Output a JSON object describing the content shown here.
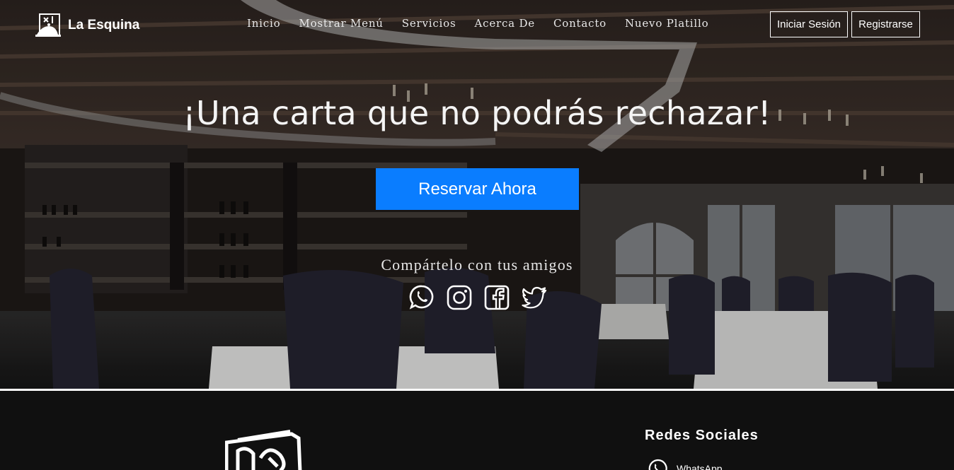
{
  "brand": {
    "name": "La Esquina",
    "logo_icon": "waiter-tray-icon"
  },
  "nav": {
    "links": [
      "Inicio",
      "Mostrar Menú",
      "Servicios",
      "Acerca De",
      "Contacto",
      "Nuevo Platillo"
    ],
    "login_label": "Iniciar Sesión",
    "register_label": "Registrarse"
  },
  "hero": {
    "title": "¡Una carta que no podrás rechazar!",
    "reserve_label": "Reservar Ahora",
    "share_text": "Compártelo con tus amigos",
    "social_icons": [
      "whatsapp-icon",
      "instagram-icon",
      "facebook-icon",
      "twitter-icon"
    ]
  },
  "footer": {
    "social_heading": "Redes Sociales",
    "social_items": [
      {
        "label": "WhatsApp",
        "icon": "whatsapp-icon"
      }
    ]
  },
  "colors": {
    "accent": "#0a7dff",
    "footer_bg": "#101010",
    "text": "#ffffff"
  }
}
